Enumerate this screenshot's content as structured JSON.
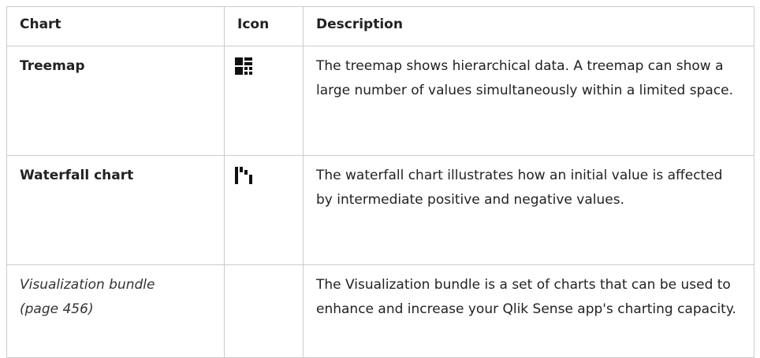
{
  "table": {
    "headers": {
      "chart": "Chart",
      "icon": "Icon",
      "description": "Description"
    },
    "rows": [
      {
        "chart": "Treemap",
        "icon": "treemap-icon",
        "description": "The treemap shows hierarchical data. A treemap can show a large number of values simultaneously within a limited space."
      },
      {
        "chart": "Waterfall chart",
        "icon": "waterfall-chart-icon",
        "description": "The waterfall chart illustrates how an initial value is affected by intermediate positive and negative values."
      },
      {
        "chart_line1": "Visualization bundle",
        "chart_line2": "(page 456)",
        "icon": "",
        "description": "The Visualization bundle is a set of charts that can be used to enhance and increase your Qlik Sense app's charting capacity."
      }
    ]
  },
  "colors": {
    "border": "#cccccc",
    "text": "#222222",
    "icon": "#111111"
  }
}
